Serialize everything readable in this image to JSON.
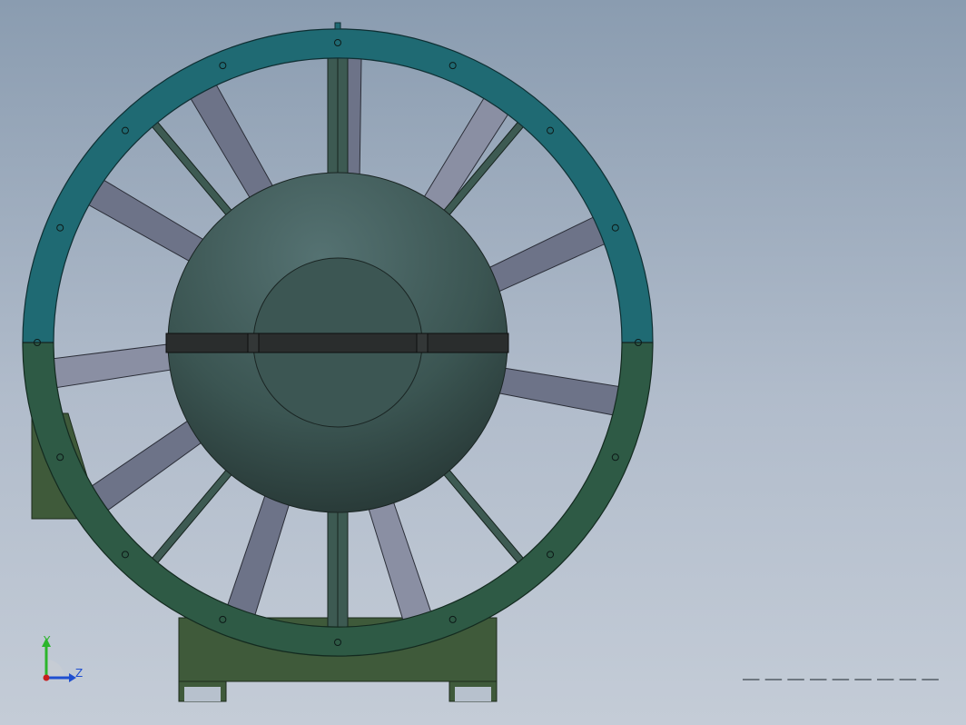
{
  "viewport": {
    "background": "#a4b1c2"
  },
  "model": {
    "name": "axial-fan-assembly",
    "colors": {
      "flange_top": "#1f6a73",
      "flange_bottom": "#2e5a45",
      "blade": "#6d7388",
      "blade_light": "#8a8fa3",
      "hub": "#3e5b57",
      "band": "#2a2d2d",
      "base": "#3f5a3a",
      "strut": "#3d5a52"
    }
  },
  "triad": {
    "y_label": "Y",
    "z_label": "Z",
    "y_color": "#2cb52c",
    "z_color": "#1f4fd0",
    "origin_color": "#c81e1e"
  },
  "scale_bar": {
    "segments": 9,
    "color": "#6e7780"
  }
}
